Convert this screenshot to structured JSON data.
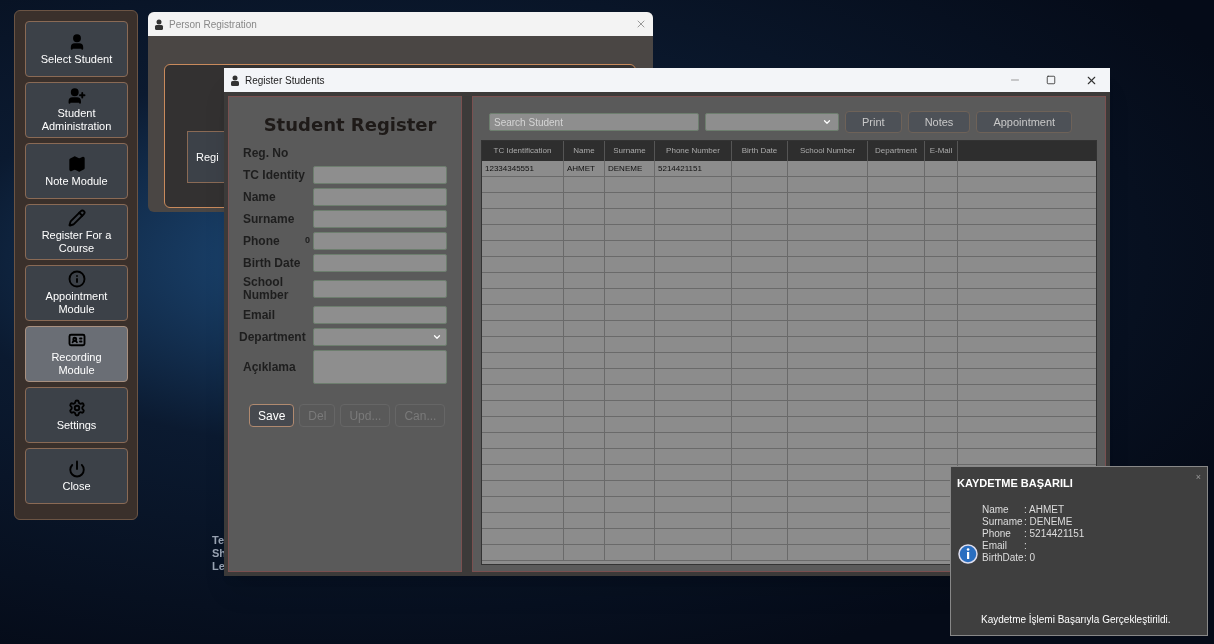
{
  "sidebar": {
    "items": [
      {
        "label": "Select Student",
        "selected": false
      },
      {
        "label": "Student Administration",
        "selected": false
      },
      {
        "label": "Note Module",
        "selected": false
      },
      {
        "label": "Register For a Course",
        "selected": false
      },
      {
        "label": "Appointment Module",
        "selected": false
      },
      {
        "label": "Recording Module",
        "selected": true
      },
      {
        "label": "Settings",
        "selected": false
      },
      {
        "label": "Close",
        "selected": false
      }
    ]
  },
  "desktop_text": [
    "Te",
    "Sh",
    "Le"
  ],
  "person_window": {
    "title": "Person Registration",
    "button": "Regi"
  },
  "register_window": {
    "title": "Register Students",
    "form": {
      "title": "Student Register",
      "fields": [
        {
          "label": "Reg. No",
          "kind": "label"
        },
        {
          "label": "TC Identity",
          "kind": "text"
        },
        {
          "label": "Name",
          "kind": "text"
        },
        {
          "label": "Surname",
          "kind": "text"
        },
        {
          "label": "Phone",
          "kind": "text",
          "prefix": "0"
        },
        {
          "label": "Birth Date",
          "kind": "text"
        },
        {
          "label": "School Number",
          "kind": "text"
        },
        {
          "label": "Email",
          "kind": "text"
        },
        {
          "label": "Department",
          "kind": "dropdown"
        },
        {
          "label": "Açıklama",
          "kind": "textarea"
        }
      ],
      "buttons": [
        {
          "label": "Save",
          "disabled": false
        },
        {
          "label": "Del",
          "disabled": true
        },
        {
          "label": "Upd...",
          "disabled": true
        },
        {
          "label": "Can...",
          "disabled": true
        }
      ]
    },
    "search": {
      "placeholder": "Search Student"
    },
    "toolbar_buttons": [
      "Print",
      "Notes",
      "Appointment"
    ],
    "table": {
      "columns": [
        "TC Identification",
        "Name",
        "Surname",
        "Phone Number",
        "Birth Date",
        "School Number",
        "Department",
        "E-Mail"
      ],
      "rows": [
        [
          "12334345551",
          "AHMET",
          "DENEME",
          "5214421151",
          "",
          "",
          "",
          ""
        ]
      ]
    }
  },
  "toast": {
    "title": "KAYDETME BAŞARILI",
    "close": "×",
    "details": [
      {
        "label": "Name",
        "value": ": AHMET"
      },
      {
        "label": "Surname",
        "value": ": DENEME"
      },
      {
        "label": "Phone",
        "value": ": 5214421151"
      },
      {
        "label": "Email",
        "value": ":"
      },
      {
        "label": "BirthDate",
        "value": ": 0"
      }
    ],
    "message": "Kaydetme İşlemi Başarıyla Gerçekleştirildi."
  }
}
